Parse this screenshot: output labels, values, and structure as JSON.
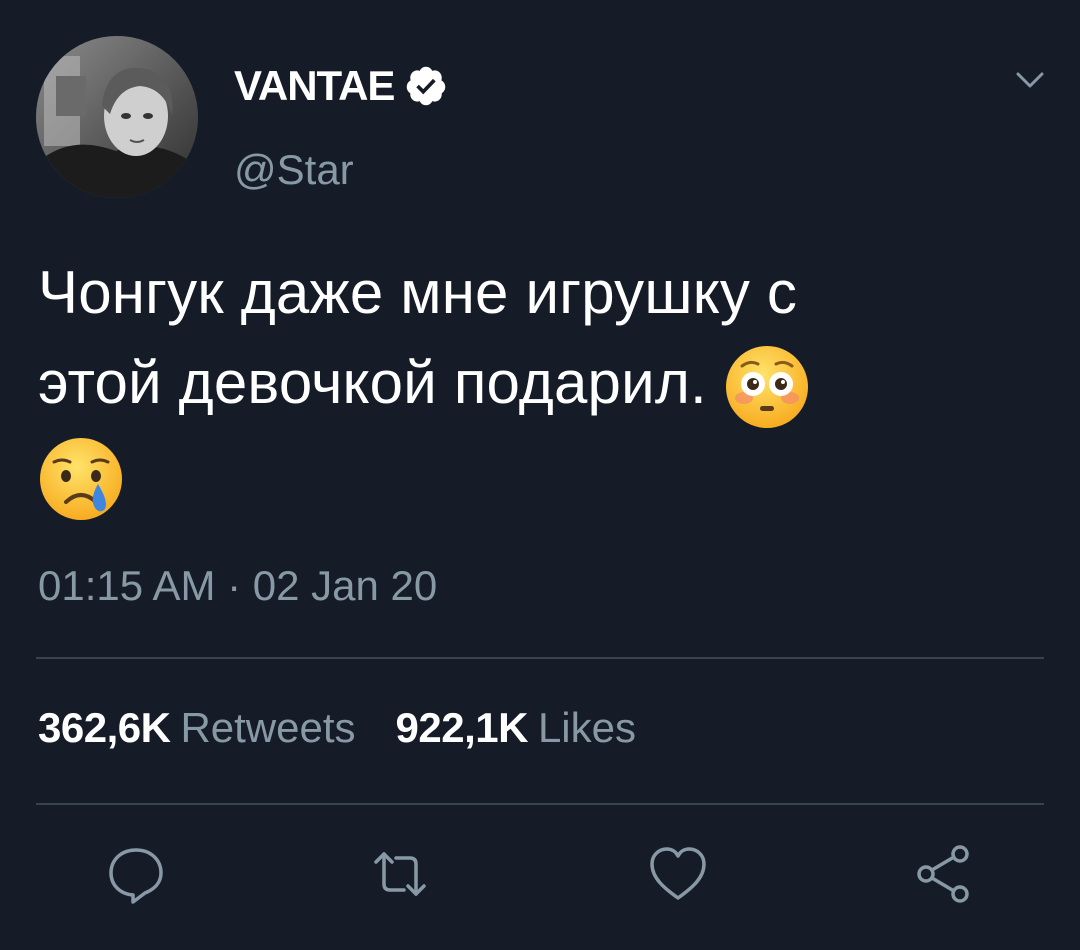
{
  "tweet": {
    "author": {
      "display_name": "VANTAE",
      "handle": "@Star",
      "verified": true
    },
    "text_line_1": "Чонгук даже мне игрушку с",
    "text_line_2": "этой девочкой подарил.",
    "emojis": [
      "flushed-face",
      "sad-but-relieved-face"
    ],
    "timestamp": "01:15 AM · 02 Jan 20",
    "stats": {
      "retweets_count": "362,6K",
      "retweets_label": "Retweets",
      "likes_count": "922,1K",
      "likes_label": "Likes"
    },
    "actions": [
      "reply-icon",
      "retweet-icon",
      "like-icon",
      "share-icon"
    ]
  },
  "colors": {
    "background": "#151c28",
    "text_primary": "#ffffff",
    "text_secondary": "#8899a6",
    "divider": "#38444d"
  }
}
